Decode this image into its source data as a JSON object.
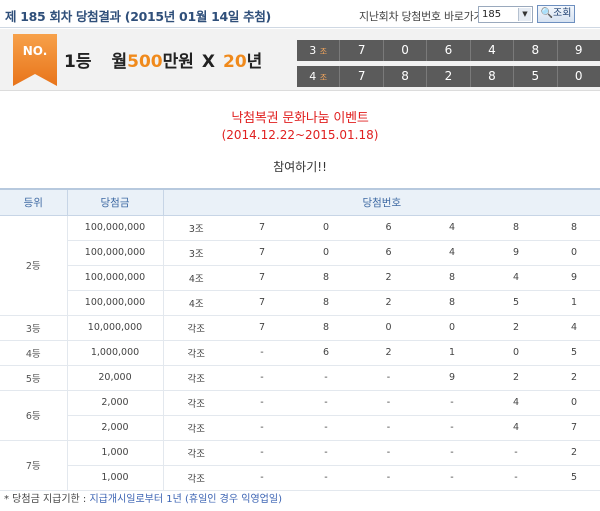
{
  "header": {
    "title": "제 185 회차 당첨결과 (2015년 01월 14일 추첨)",
    "past_label": "지난회차 당첨번호 바로가기",
    "round_value": "185",
    "search_label": "조회"
  },
  "banner": {
    "ribbon_text": "NO.",
    "rank": "1등",
    "prize_prefix": "월",
    "prize_amount": "500",
    "prize_unit": "만원",
    "times": "X",
    "years": "20",
    "years_unit": "년",
    "rows": [
      {
        "group": "3",
        "group_unit": "조",
        "numbers": [
          "7",
          "0",
          "6",
          "4",
          "8",
          "9"
        ]
      },
      {
        "group": "4",
        "group_unit": "조",
        "numbers": [
          "7",
          "8",
          "2",
          "8",
          "5",
          "0"
        ]
      }
    ]
  },
  "event": {
    "name": "낙첨복권 문화나눔 이벤트",
    "period": "(2014.12.22~2015.01.18)",
    "participate": "참여하기!!"
  },
  "table": {
    "headers": {
      "rank": "등위",
      "amount": "당첨금",
      "numbers": "당첨번호"
    },
    "rows": [
      {
        "rank": "2등",
        "amount": "100,000,000",
        "group": "3조",
        "nums": [
          "7",
          "0",
          "6",
          "4",
          "8",
          "8"
        ]
      },
      {
        "rank": "",
        "amount": "100,000,000",
        "group": "3조",
        "nums": [
          "7",
          "0",
          "6",
          "4",
          "9",
          "0"
        ]
      },
      {
        "rank": "",
        "amount": "100,000,000",
        "group": "4조",
        "nums": [
          "7",
          "8",
          "2",
          "8",
          "4",
          "9"
        ]
      },
      {
        "rank": "",
        "amount": "100,000,000",
        "group": "4조",
        "nums": [
          "7",
          "8",
          "2",
          "8",
          "5",
          "1"
        ]
      },
      {
        "rank": "3등",
        "amount": "10,000,000",
        "group": "각조",
        "nums": [
          "7",
          "8",
          "0",
          "0",
          "2",
          "4"
        ]
      },
      {
        "rank": "4등",
        "amount": "1,000,000",
        "group": "각조",
        "nums": [
          "-",
          "6",
          "2",
          "1",
          "0",
          "5"
        ]
      },
      {
        "rank": "5등",
        "amount": "20,000",
        "group": "각조",
        "nums": [
          "-",
          "-",
          "-",
          "9",
          "2",
          "2"
        ]
      },
      {
        "rank": "6등",
        "amount": "2,000",
        "group": "각조",
        "nums": [
          "-",
          "-",
          "-",
          "-",
          "4",
          "0"
        ]
      },
      {
        "rank": "",
        "amount": "2,000",
        "group": "각조",
        "nums": [
          "-",
          "-",
          "-",
          "-",
          "4",
          "7"
        ]
      },
      {
        "rank": "7등",
        "amount": "1,000",
        "group": "각조",
        "nums": [
          "-",
          "-",
          "-",
          "-",
          "-",
          "2"
        ]
      },
      {
        "rank": "",
        "amount": "1,000",
        "group": "각조",
        "nums": [
          "-",
          "-",
          "-",
          "-",
          "-",
          "5"
        ]
      }
    ]
  },
  "footnote": {
    "label": "* 당첨금 지급기한 : ",
    "text": "지급개시일로부터 1년 (휴일인 경우 익영업일)"
  },
  "colors": {
    "accent": "#f08a1c",
    "event": "#e02020",
    "header_blue": "#3f6aa3"
  }
}
